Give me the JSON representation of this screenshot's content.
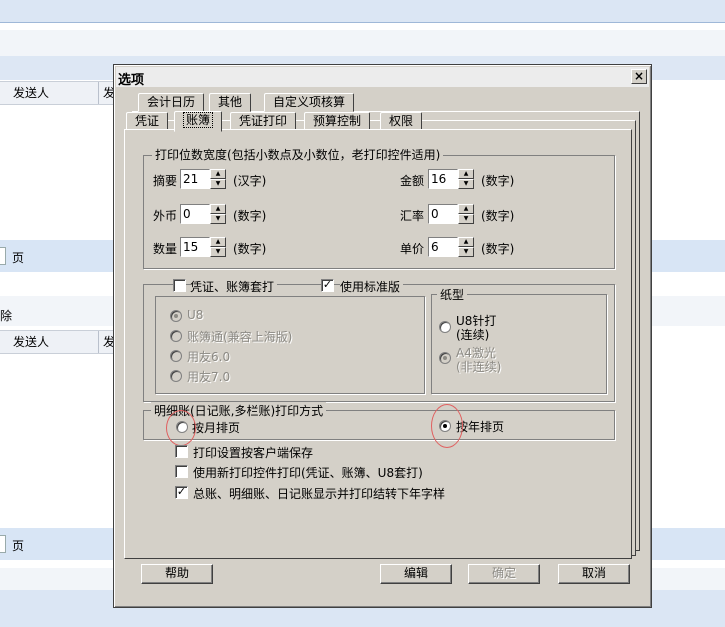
{
  "background": {
    "column_header_1": [
      "发送人",
      "发"
    ],
    "pager_1": "页",
    "delete_label": "除",
    "column_header_2": [
      "发送人",
      "发"
    ],
    "pager_2": "页"
  },
  "dialog": {
    "title": "选项",
    "close_glyph": "×",
    "tabs_back_row": [
      "会计日历",
      "其他",
      "自定义项核算"
    ],
    "tabs_front_row": [
      "凭证",
      "账簿",
      "凭证打印",
      "预算控制",
      "权限"
    ],
    "active_tab": "账簿",
    "print_width_group": {
      "label": "打印位数宽度(包括小数点及小数位，老打印控件适用)",
      "fields": [
        {
          "label": "摘要",
          "value": "21",
          "unit": "(汉字)"
        },
        {
          "label": "外币",
          "value": "0",
          "unit": "(数字)"
        },
        {
          "label": "数量",
          "value": "15",
          "unit": "(数字)"
        },
        {
          "label": "金额",
          "value": "16",
          "unit": "(数字)"
        },
        {
          "label": "汇率",
          "value": "0",
          "unit": "(数字)"
        },
        {
          "label": "单价",
          "value": "6",
          "unit": "(数字)"
        }
      ]
    },
    "voucher_book_set_print": {
      "label": "凭证、账簿套打",
      "checked": false
    },
    "use_standard_version": {
      "label": "使用标准版",
      "checked": true
    },
    "version_options": [
      {
        "label": "U8",
        "checked": true
      },
      {
        "label": "账簿通(兼容上海版)",
        "checked": false
      },
      {
        "label": "用友6.0",
        "checked": false
      },
      {
        "label": "用友7.0",
        "checked": false
      }
    ],
    "paper_group": {
      "label": "纸型",
      "options": [
        {
          "label": "U8针打",
          "sub": "(连续)",
          "checked": false
        },
        {
          "label": "A4激光",
          "sub": "(非连续)",
          "checked": true
        }
      ]
    },
    "detail_print_group": {
      "label": "明细账(日记账,多栏账)打印方式",
      "options": [
        {
          "label": "按月排页",
          "checked": false
        },
        {
          "label": "按年排页",
          "checked": true
        }
      ]
    },
    "checkboxes": [
      {
        "label": "打印设置按客户端保存",
        "checked": false
      },
      {
        "label": "使用新打印控件打印(凭证、账簿、U8套打)",
        "checked": false
      },
      {
        "label": "总账、明细账、日记账显示并打印结转下年字样",
        "checked": true
      }
    ],
    "buttons": {
      "help": "帮助",
      "edit": "编辑",
      "ok": "确定",
      "cancel": "取消"
    },
    "check_glyph": "✓"
  }
}
